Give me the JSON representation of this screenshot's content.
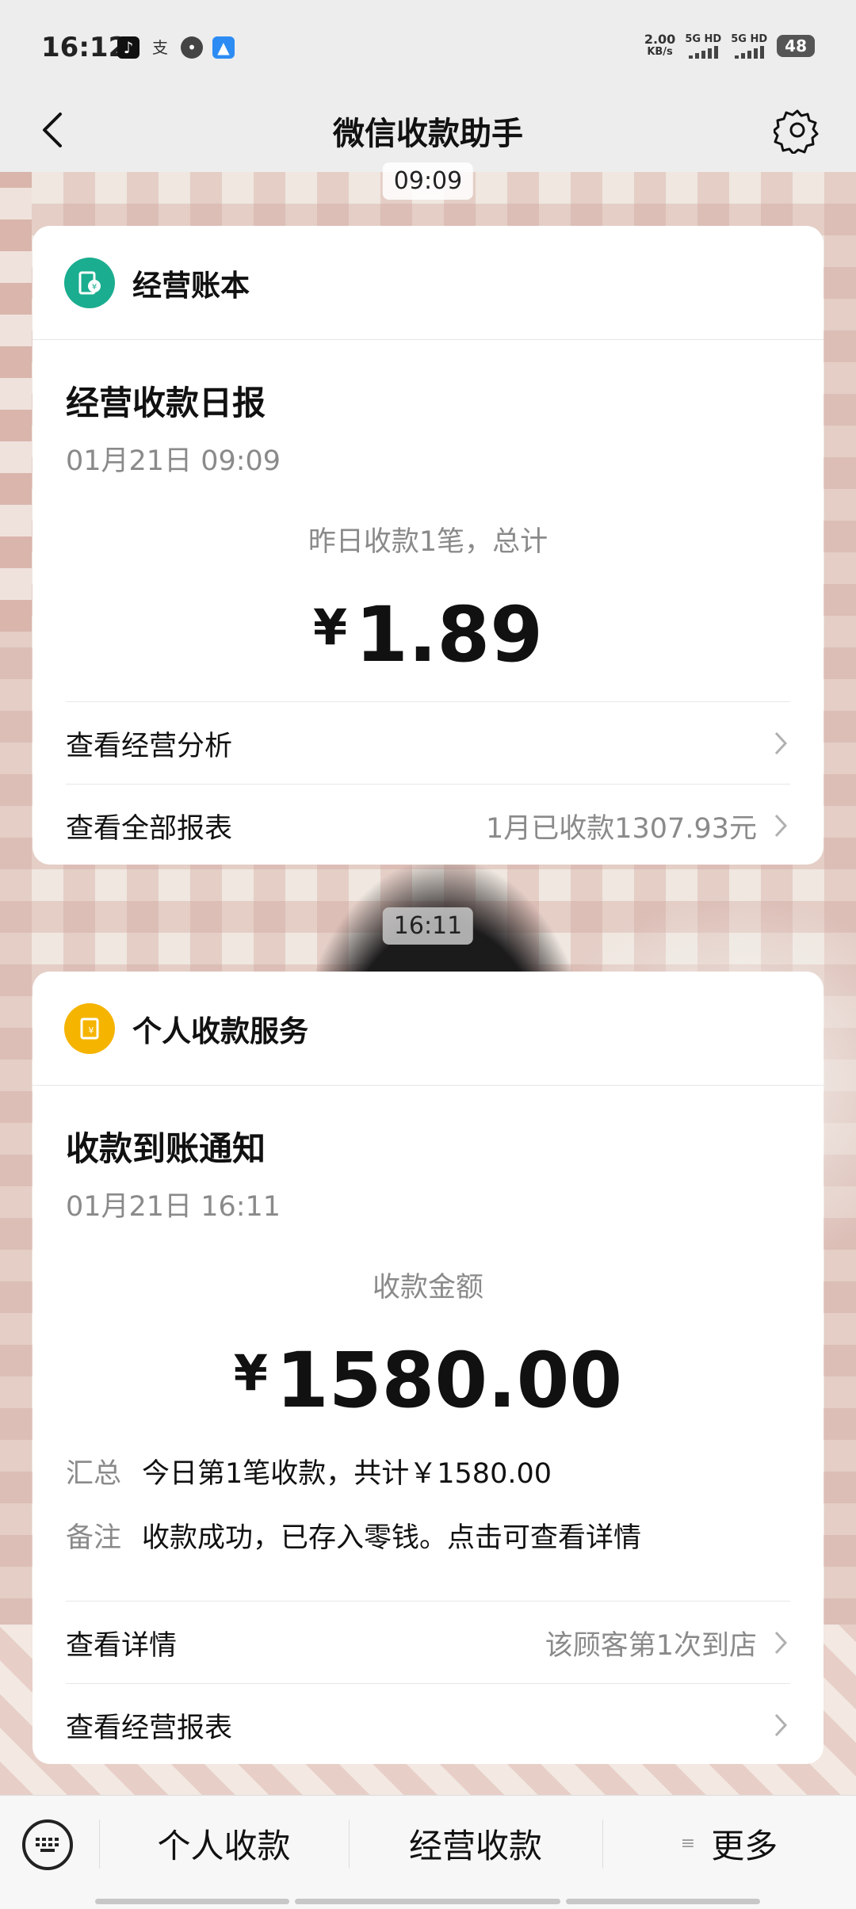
{
  "status_bar": {
    "time": "16:12",
    "net_speed_value": "2.00",
    "net_speed_unit": "KB/s",
    "sim1": "5G HD",
    "sim2": "5G HD",
    "battery": "48",
    "app_icons": [
      "tiktok-icon",
      "alipay-icon",
      "message-icon",
      "feishu-icon"
    ]
  },
  "nav": {
    "title": "微信收款助手"
  },
  "timestamps": [
    "09:09",
    "16:11"
  ],
  "card_business": {
    "header_title": "经营账本",
    "title": "经营收款日报",
    "date": "01月21日 09:09",
    "summary_label": "昨日收款1笔，总计",
    "currency": "¥",
    "amount": "1.89",
    "row_analysis": "查看经营分析",
    "row_reports": "查看全部报表",
    "row_reports_value": "1月已收款1307.93元"
  },
  "card_personal": {
    "header_title": "个人收款服务",
    "title": "收款到账通知",
    "date": "01月21日 16:11",
    "amount_label": "收款金额",
    "currency": "¥",
    "amount": "1580.00",
    "summary_key": "汇总",
    "summary_value": "今日第1笔收款，共计￥1580.00",
    "note_key": "备注",
    "note_value": "收款成功，已存入零钱。点击可查看详情",
    "row_details": "查看详情",
    "row_details_value": "该顾客第1次到店",
    "row_reports": "查看经营报表"
  },
  "bottom_menu": {
    "items": [
      "个人收款",
      "经营收款",
      "更多"
    ]
  },
  "colors": {
    "business_icon": "#1aad8f",
    "personal_icon": "#f5b400"
  }
}
